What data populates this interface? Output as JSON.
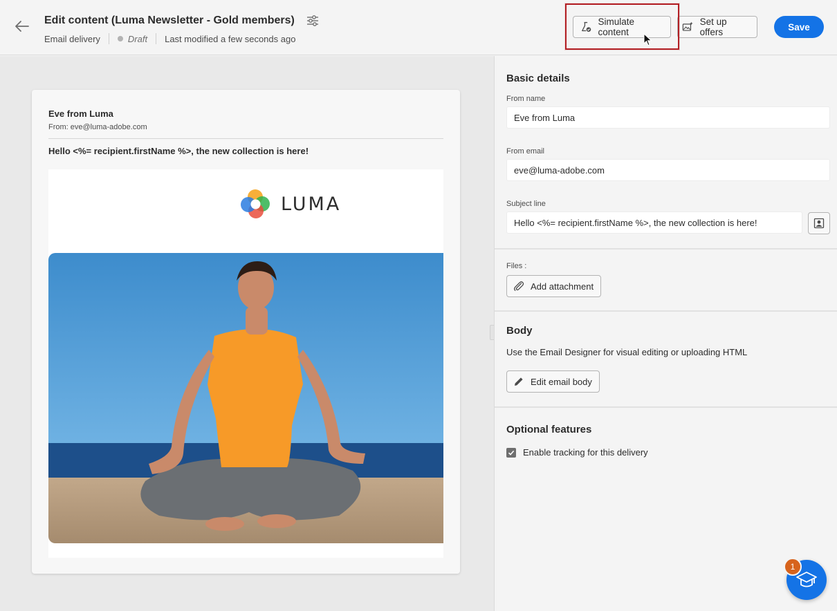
{
  "header": {
    "title": "Edit content (Luma Newsletter - Gold members)",
    "channel": "Email delivery",
    "status": "Draft",
    "last_modified": "Last modified a few seconds ago",
    "simulate_label": "Simulate content",
    "offers_label": "Set up offers",
    "save_label": "Save"
  },
  "preview": {
    "from_name": "Eve from Luma",
    "from_email": "From: eve@luma-adobe.com",
    "subject": "Hello <%= recipient.firstName %>, the new collection is here!",
    "logo_text": "LUMA"
  },
  "basic_details": {
    "section_title": "Basic details",
    "from_name_label": "From name",
    "from_name_value": "Eve from Luma",
    "from_email_label": "From email",
    "from_email_value": "eve@luma-adobe.com",
    "subject_label": "Subject line",
    "subject_value": "Hello <%= recipient.firstName %>, the new collection is here!"
  },
  "files": {
    "label": "Files :",
    "add_attachment_label": "Add attachment"
  },
  "body_section": {
    "title": "Body",
    "description": "Use the Email Designer for visual editing or uploading HTML",
    "edit_label": "Edit email body"
  },
  "optional": {
    "title": "Optional features",
    "tracking_label": "Enable tracking for this delivery",
    "tracking_checked": true
  },
  "help": {
    "badge_count": "1"
  },
  "colors": {
    "accent": "#1473e6",
    "highlight": "#b21f24",
    "badge": "#d7631c"
  }
}
